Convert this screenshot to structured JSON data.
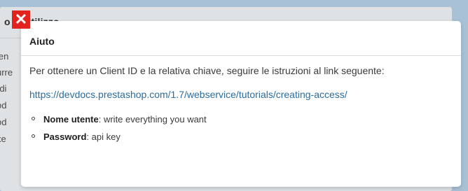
{
  "background": {
    "title_fragment": "o    di utilizzo",
    "rows": [
      "ien",
      "urre",
      "rdi",
      "od",
      "od",
      "xe"
    ]
  },
  "modal": {
    "title": "Aiuto",
    "intro": "Per ottenere un Client ID e la relativa chiave, seguire le istruzioni al link seguente:",
    "link": "https://devdocs.prestashop.com/1.7/webservice/tutorials/creating-access/",
    "fields": [
      {
        "label": "Nome utente",
        "sep": ": ",
        "value": "write everything you want"
      },
      {
        "label": "Password",
        "sep": ": ",
        "value": "api key"
      }
    ]
  },
  "close_button": {
    "glyph": "✕",
    "icon": "close-icon",
    "color": "#e3241e"
  },
  "colors": {
    "link": "#2c6c9e",
    "backdrop": "#a9c1d6"
  }
}
